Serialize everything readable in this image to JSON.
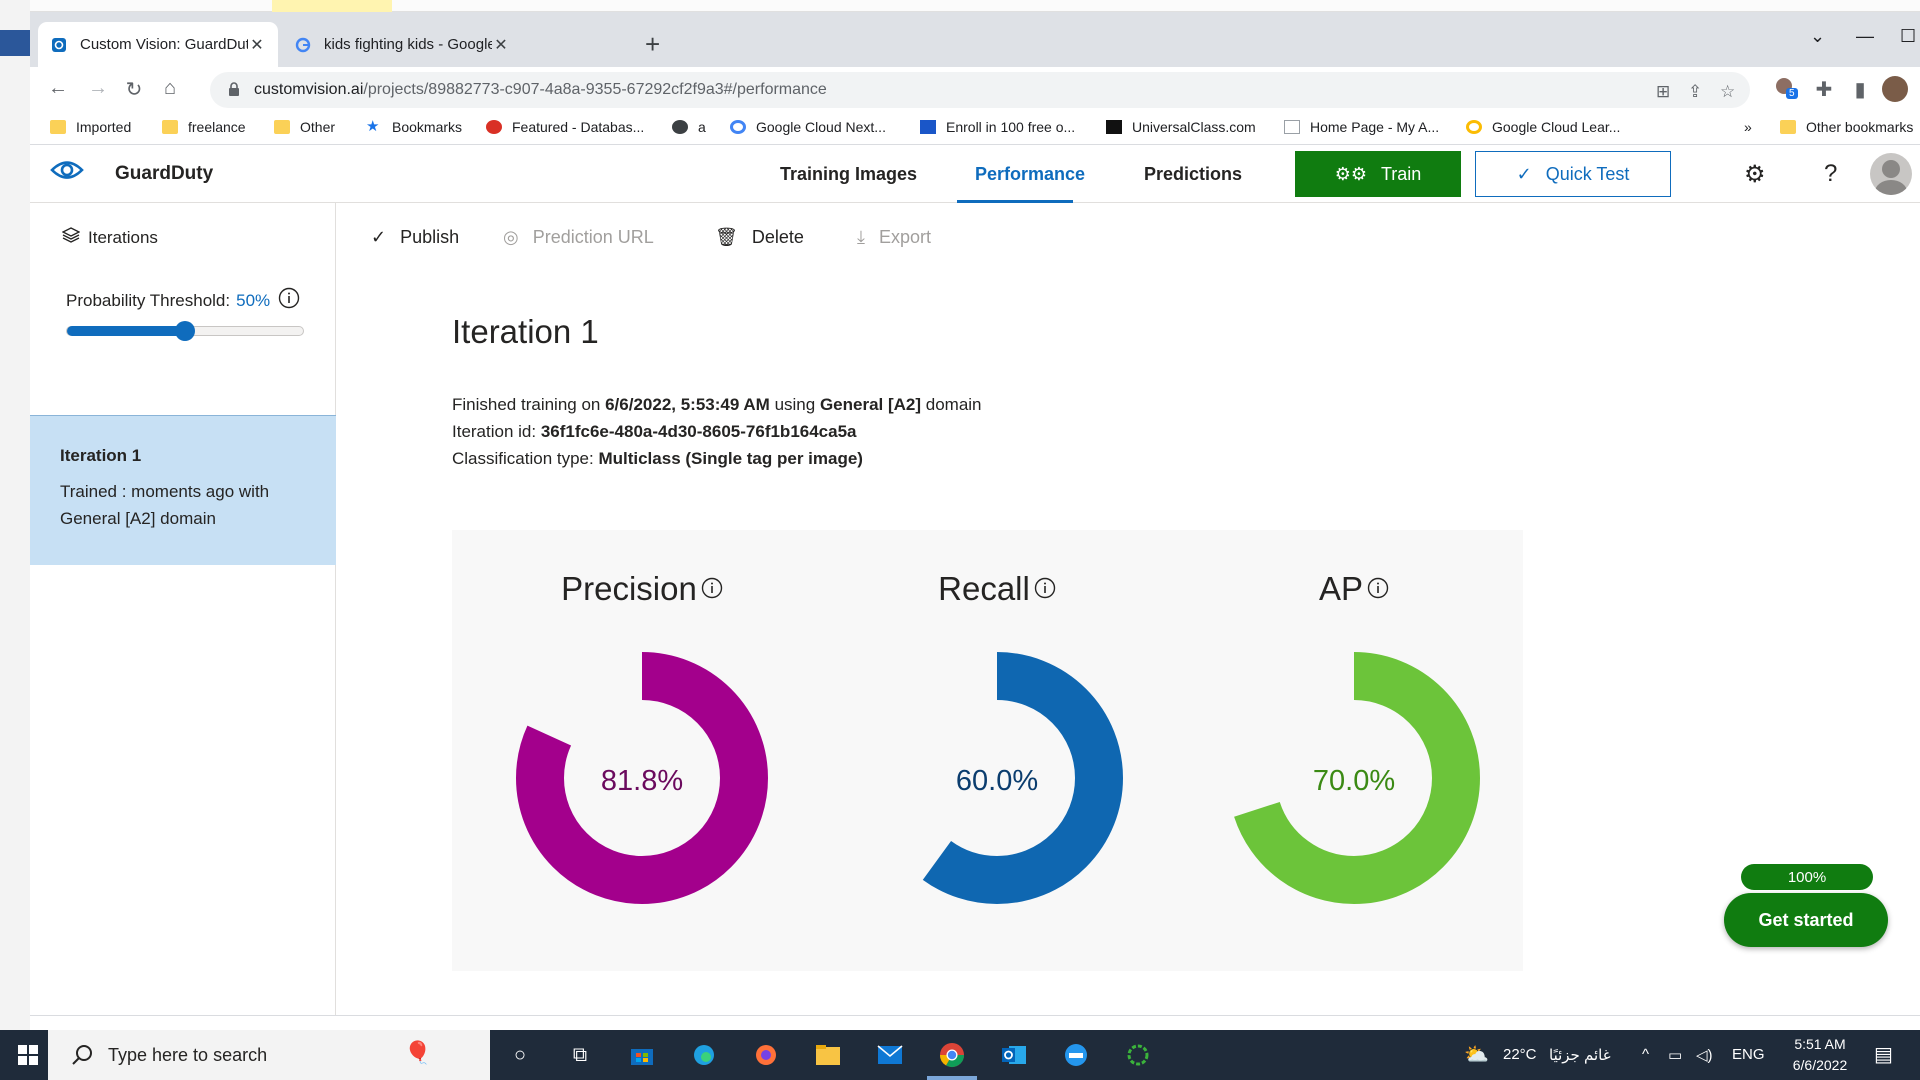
{
  "browser": {
    "tabs": [
      {
        "title": "Custom Vision: GuardDuty - Perfo",
        "active": true
      },
      {
        "title": "kids fighting kids - Google Searc",
        "active": false
      }
    ],
    "url_host": "customvision.ai",
    "url_path": "/projects/89882773-c907-4a8a-9355-67292cf2f9a3#/performance",
    "extension_badge": "5",
    "bookmarks": [
      {
        "label": "Imported",
        "icon": "folder-icon"
      },
      {
        "label": "freelance",
        "icon": "folder-icon"
      },
      {
        "label": "Other",
        "icon": "folder-icon"
      },
      {
        "label": "Bookmarks",
        "icon": "star-icon"
      },
      {
        "label": "Featured - Databas...",
        "icon": "site-icon"
      },
      {
        "label": "a",
        "icon": "site-icon"
      },
      {
        "label": "Google Cloud Next...",
        "icon": "google-cloud-icon"
      },
      {
        "label": "Enroll in 100 free o...",
        "icon": "site-icon"
      },
      {
        "label": "UniversalClass.com",
        "icon": "site-icon"
      },
      {
        "label": "Home Page - My A...",
        "icon": "site-icon"
      },
      {
        "label": "Google Cloud Lear...",
        "icon": "google-cloud-icon"
      }
    ],
    "bookmarks_overflow": "»",
    "other_bookmarks": "Other bookmarks"
  },
  "header": {
    "project_name": "GuardDuty",
    "nav": [
      "Training Images",
      "Performance",
      "Predictions"
    ],
    "active_nav": "Performance",
    "train_label": "Train",
    "quick_test_label": "Quick Test"
  },
  "sidebar": {
    "iterations_label": "Iterations",
    "threshold_label": "Probability Threshold:",
    "threshold_value": "50%",
    "threshold_fraction": 0.5,
    "iteration": {
      "name": "Iteration 1",
      "desc_line1": "Trained : moments ago with",
      "desc_line2": "General [A2] domain"
    }
  },
  "commands": {
    "publish": "Publish",
    "prediction_url": "Prediction URL",
    "delete": "Delete",
    "export": "Export"
  },
  "main": {
    "title": "Iteration 1",
    "finished_prefix": "Finished training on ",
    "finished_date": "6/6/2022, 5:53:49 AM",
    "finished_mid": " using ",
    "domain": "General [A2]",
    "finished_suffix": " domain",
    "iteration_id_label": "Iteration id: ",
    "iteration_id": "36f1fc6e-480a-4d30-8605-76f1b164ca5a",
    "classification_label": "Classification type: ",
    "classification": "Multiclass (Single tag per image)"
  },
  "metrics": [
    {
      "label": "Precision",
      "value_text": "81.8%",
      "value": 0.818,
      "color": "#a3008c",
      "text_color": "#6b0a5e"
    },
    {
      "label": "Recall",
      "value_text": "60.0%",
      "value": 0.6,
      "color": "#0f67b1",
      "text_color": "#0b3d6e"
    },
    {
      "label": "AP",
      "value_text": "70.0%",
      "value": 0.7,
      "color": "#6cc43a",
      "text_color": "#3b8a14"
    }
  ],
  "onboarding": {
    "progress": "100%",
    "get_started": "Get started"
  },
  "taskbar": {
    "search_placeholder": "Type here to search",
    "weather_temp": "22°C",
    "weather_text": "غائم جزئيًا",
    "language": "ENG",
    "time": "5:51 AM",
    "date": "6/6/2022"
  }
}
